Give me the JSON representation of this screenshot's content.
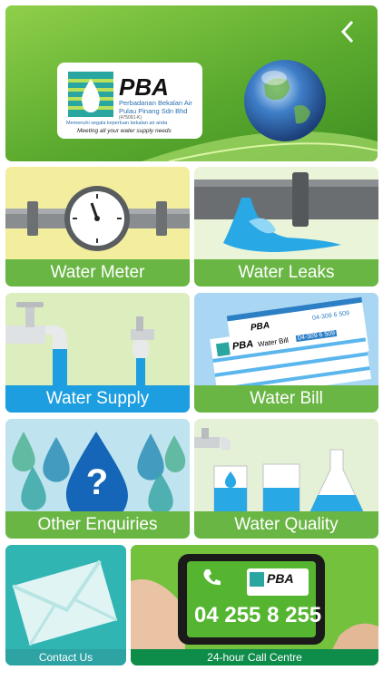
{
  "header": {
    "logo_brand": "PBA",
    "logo_line1": "Perbadanan Bekalan Air",
    "logo_line2": "Pulau Pinang Sdn Bhd",
    "logo_reg": "(475091-K)",
    "logo_tagline_ms": "Memenuhi segala keperluan bekalan air anda",
    "logo_tagline_en": "Meeting all your water supply needs",
    "back_icon": "chevron-left-icon"
  },
  "tiles": {
    "water_meter": "Water Meter",
    "water_leaks": "Water Leaks",
    "water_supply": "Water Supply",
    "water_bill": "Water Bill",
    "other_enquiries": "Other Enquiries",
    "water_quality": "Water Quality",
    "contact_us": "Contact Us",
    "call_centre": "24-hour Call Centre"
  },
  "bill_card": {
    "brand": "PBA",
    "title": "Water Bill",
    "account": "04-309 6 509",
    "account_back": "04-309 6 509",
    "brand_back": "PBA"
  },
  "phone_card": {
    "brand": "PBA",
    "number": "04 255 8 255"
  },
  "colors": {
    "label_green": "#6ab645",
    "header_green": "#5ea83a",
    "teal": "#2ea3a3",
    "water_blue": "#1fa3e0"
  }
}
